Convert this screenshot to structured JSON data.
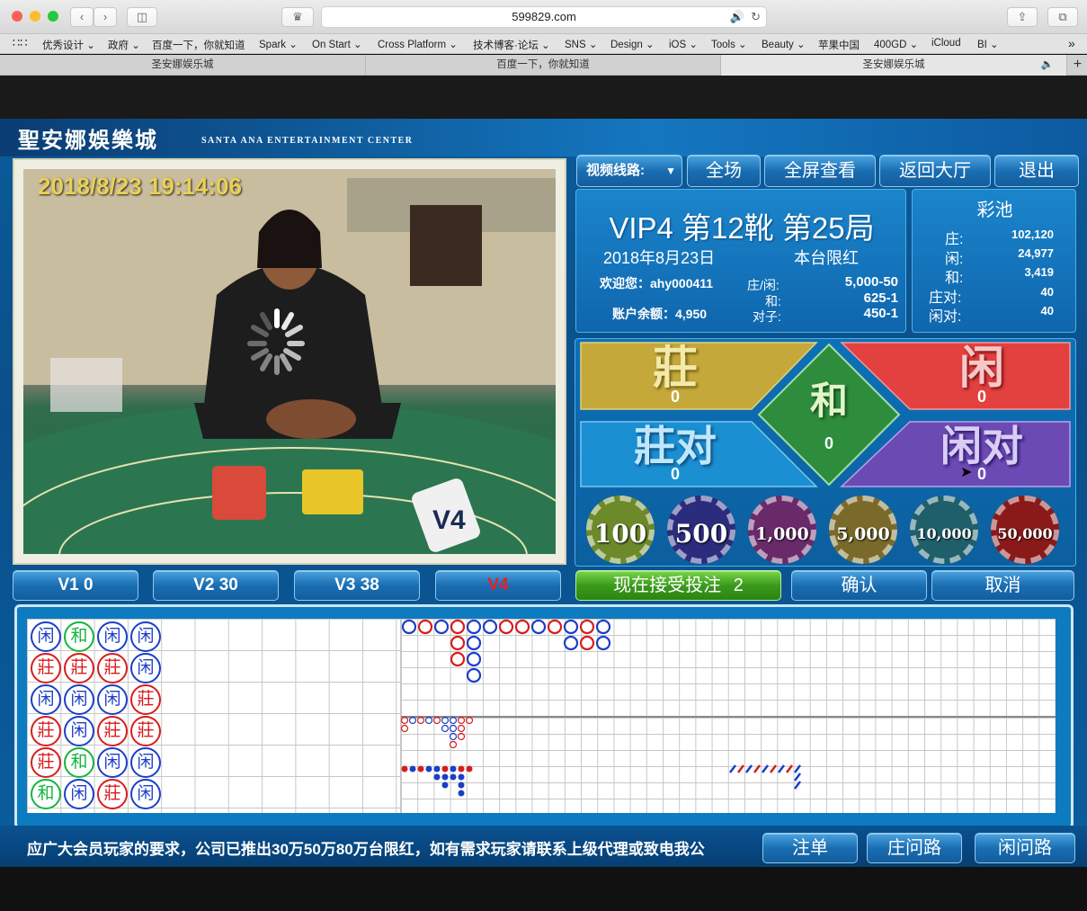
{
  "browser": {
    "url": "599829.com",
    "bookmarks": [
      "优秀设计 ⌄",
      "政府 ⌄",
      "百度一下，你就知道",
      "Spark ⌄",
      "On Start ⌄",
      "Cross Platform ⌄",
      "技术博客·论坛 ⌄",
      "SNS ⌄",
      "Design ⌄",
      "iOS ⌄",
      "Tools ⌄",
      "Beauty ⌄",
      "苹果中国",
      "400GD ⌄",
      "iCloud",
      "BI ⌄"
    ],
    "tabs": [
      "圣安娜娱乐城",
      "百度一下，你就知道",
      "圣安娜娱乐城"
    ]
  },
  "logo": {
    "cn": "聖安娜娛樂城",
    "en": "SANTA ANA ENTERTAINMENT CENTER"
  },
  "video": {
    "timestamp": "2018/8/23 19:14:06"
  },
  "controls": {
    "line_select": "视频线路:",
    "full_field": "全场",
    "fullscreen": "全屏查看",
    "lobby": "返回大厅",
    "exit": "退出"
  },
  "table_info": {
    "title": "VIP4 第12靴 第25局",
    "date": "2018年8月23日",
    "limit_label": "本台限红",
    "welcome": "欢迎您：ahy000411",
    "balance": "账户余额：4,950",
    "limits": [
      {
        "label": "庄/闲:",
        "value": "5,000-50"
      },
      {
        "label": "和:",
        "value": "625-1"
      },
      {
        "label": "对子:",
        "value": "450-1"
      }
    ]
  },
  "pool": {
    "title": "彩池",
    "items": [
      {
        "label": "庄:",
        "value": "102,120"
      },
      {
        "label": "闲:",
        "value": "24,977"
      },
      {
        "label": "和:",
        "value": "3,419"
      },
      {
        "label": "庄对:",
        "value": "40"
      },
      {
        "label": "闲对:",
        "value": "40"
      }
    ]
  },
  "bets": {
    "banker": {
      "label": "莊",
      "amount": "0"
    },
    "player": {
      "label": "闲",
      "amount": "0"
    },
    "tie": {
      "label": "和",
      "amount": "0"
    },
    "banker_pair": {
      "label": "莊对",
      "amount": "0"
    },
    "player_pair": {
      "label": "闲对",
      "amount": "0"
    }
  },
  "chips": [
    "100",
    "500",
    "1,000",
    "5,000",
    "10,000",
    "50,000"
  ],
  "colors": {
    "banker": "#c8b04a",
    "player": "#e23b3b",
    "tie": "#2e8b3e",
    "bpair": "#1a87c8",
    "ppair": "#6a4bb0"
  },
  "video_tabs": [
    "V1 0",
    "V2 30",
    "V3 38",
    "V4"
  ],
  "actions": {
    "status": "现在接受投注",
    "count": "2",
    "confirm": "确认",
    "cancel": "取消"
  },
  "bead_road": [
    [
      "闲",
      "和",
      "闲",
      "闲"
    ],
    [
      "莊",
      "莊",
      "莊",
      "闲"
    ],
    [
      "闲",
      "闲",
      "闲",
      "莊"
    ],
    [
      "莊",
      "闲",
      "莊",
      "莊"
    ],
    [
      "莊",
      "和",
      "闲",
      "闲"
    ],
    [
      "和",
      "闲",
      "莊",
      "闲"
    ]
  ],
  "footer": {
    "notice": "应广大会员玩家的要求，公司已推出30万50万80万台限红，如有需求玩家请联系上级代理或致电我公",
    "bet_record": "注单",
    "banker_ask": "庄问路",
    "player_ask": "闲问路"
  }
}
